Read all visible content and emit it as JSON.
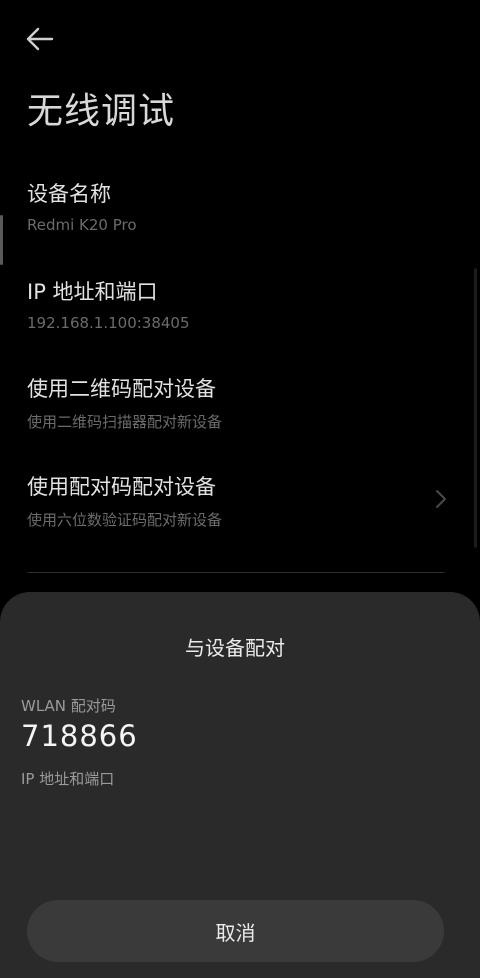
{
  "header": {
    "back_icon": "arrow-left-icon",
    "title": "无线调试"
  },
  "items": [
    {
      "title": "设备名称",
      "subtitle": "Redmi K20 Pro"
    },
    {
      "title": "IP 地址和端口",
      "subtitle": "192.168.1.100:38405"
    },
    {
      "title": "使用二维码配对设备",
      "subtitle": "使用二维码扫描器配对新设备"
    },
    {
      "title": "使用配对码配对设备",
      "subtitle": "使用六位数验证码配对新设备",
      "icon": "chevron-right-icon"
    }
  ],
  "dialog": {
    "title": "与设备配对",
    "wlan_label": "WLAN 配对码",
    "wlan_code": "718866",
    "ip_label": "IP 地址和端口",
    "cancel_label": "取消"
  },
  "colors": {
    "background": "#000000",
    "dialog_background": "#2a2a2a",
    "button_background": "#3a3a3a",
    "primary_text": "#e2e2e2",
    "secondary_text": "#6b6b6b"
  }
}
